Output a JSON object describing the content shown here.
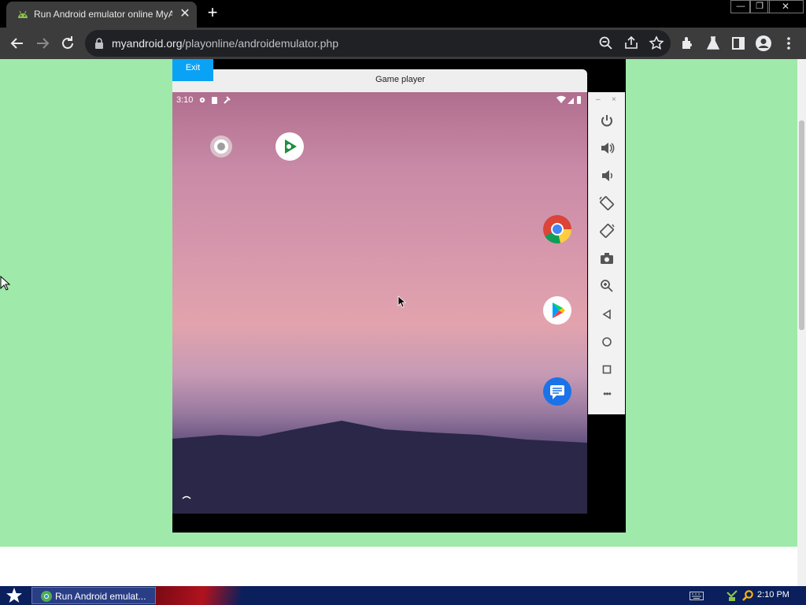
{
  "browser": {
    "tab_title": "Run Android emulator online MyAndroid",
    "tab_close": "✕",
    "new_tab": "+",
    "window_controls": {
      "minimize": "—",
      "maximize": "❐",
      "close": "✕"
    },
    "url_host": "myandroid.org",
    "url_path": "/playonline/androidemulator.php"
  },
  "page": {
    "exit_label": "Exit",
    "player_title": "Game player",
    "background_color": "#9fe9aa",
    "exit_color": "#0aa2f4"
  },
  "android": {
    "status_time": "3:10",
    "apps": [
      "settings-app-icon",
      "play-games-icon",
      "chrome-icon",
      "play-store-icon",
      "messages-icon"
    ]
  },
  "emulator_controls": [
    "power",
    "volume-up",
    "volume-down",
    "rotate-left",
    "rotate-right",
    "screenshot",
    "zoom",
    "back",
    "home",
    "overview",
    "more"
  ],
  "emulator_more": "•••",
  "taskbar": {
    "task_label": "Run Android emulat...",
    "clock": "2:10 PM"
  }
}
